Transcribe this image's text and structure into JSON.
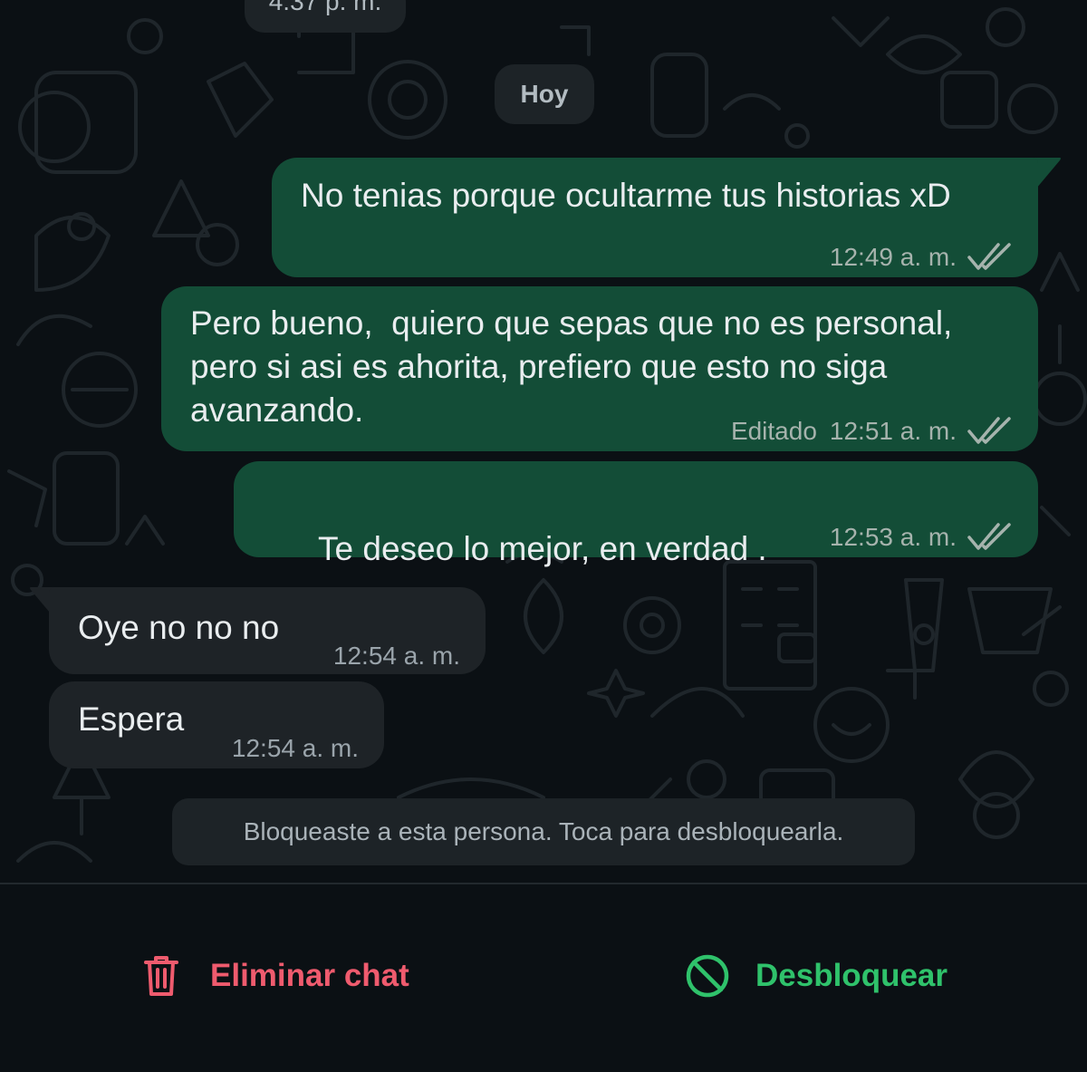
{
  "chat": {
    "prev_timestamp": "4:37 p. m.",
    "date_label": "Hoy",
    "messages": [
      {
        "direction": "out",
        "lines": [
          "No tenias porque ocultarme tus historias xD"
        ],
        "time": "12:49 a. m.",
        "status": "read"
      },
      {
        "direction": "out",
        "lines": [
          "Pero bueno,  quiero que sepas que no es personal,",
          "pero si asi es ahorita, prefiero que esto no siga",
          "avanzando."
        ],
        "edited": "Editado",
        "time": "12:51 a. m.",
        "status": "read"
      },
      {
        "direction": "out",
        "text": "Te deseo lo mejor, en verdad .",
        "emoji": "✨",
        "time": "12:53 a. m.",
        "status": "read"
      },
      {
        "direction": "in",
        "text": "Oye no no no",
        "time": "12:54 a. m."
      },
      {
        "direction": "in",
        "text": "Espera",
        "time": "12:54 a. m."
      }
    ],
    "blocked_notice": "Bloqueaste a esta persona. Toca para desbloquearla."
  },
  "bottom_bar": {
    "delete_label": "Eliminar chat",
    "delete_icon": "trash-icon",
    "unblock_label": "Desbloquear",
    "unblock_icon": "block-icon"
  },
  "colors": {
    "background": "#0b1014",
    "outgoing_bubble": "#134d37",
    "incoming_bubble": "#1e2327",
    "delete_red": "#ef5b6e",
    "unblock_green": "#2fc26b"
  }
}
